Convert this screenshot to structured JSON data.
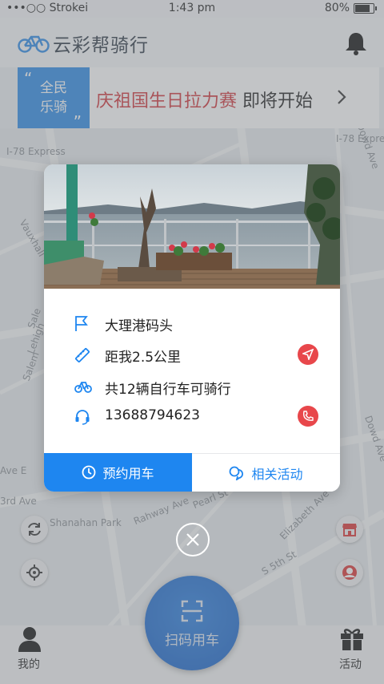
{
  "status_bar": {
    "carrier": "•••○○ Strokei",
    "time": "1:43 pm",
    "battery": "80%"
  },
  "header": {
    "title": "云彩帮骑行"
  },
  "banner": {
    "badge_line1": "全民",
    "badge_line2": "乐骑",
    "quote_open": "“",
    "quote_close": "”",
    "highlight": "庆祖国生日拉力赛",
    "rest": " 即将开始"
  },
  "map_labels": [
    "I-78 Express",
    "I-78 Expre",
    "Rahway Ave",
    "Pearl St",
    "Elizabeth Ave",
    "Shanahan Park",
    "S 5th St",
    "Dowd Ave",
    "Dowd Ave",
    "3rd Ave",
    "Lehigh",
    "Sale",
    "Salem",
    "Ave E",
    "Vauxhall"
  ],
  "modal": {
    "location": "大理港码头",
    "distance": "距我2.5公里",
    "bikes": "共12辆自行车可骑行",
    "phone": "13688794623",
    "reserve_label": "预约用车",
    "activities_label": "相关活动"
  },
  "bottom": {
    "scan_label": "扫码用车",
    "mine_label": "我的",
    "activity_label": "活动"
  },
  "colors": {
    "primary": "#1e86f0",
    "accent_red": "#e8474b",
    "banner_red": "#d2333a"
  },
  "icons": [
    "bike-logo-icon",
    "bell-icon",
    "chevron-right-icon",
    "flag-icon",
    "ruler-icon",
    "bicycle-icon",
    "headset-icon",
    "navigate-icon",
    "phone-icon",
    "clock-icon",
    "chat-bubbles-icon",
    "close-icon",
    "refresh-icon",
    "locate-icon",
    "store-icon",
    "avatar-icon",
    "user-icon",
    "gift-icon",
    "scan-icon"
  ]
}
